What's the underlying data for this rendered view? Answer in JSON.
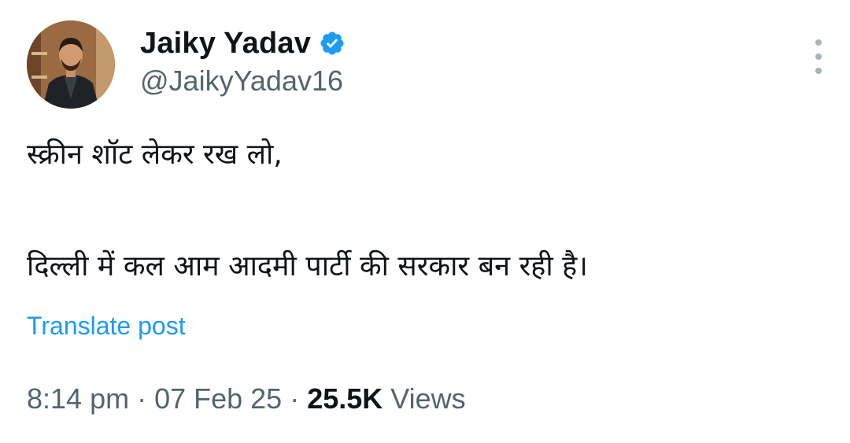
{
  "author": {
    "display_name": "Jaiky Yadav",
    "handle": "@JaikyYadav16",
    "verified": true,
    "verified_color": "#1d9bf0"
  },
  "tweet": {
    "lines": [
      "स्क्रीन शॉट लेकर रख लो,",
      "दिल्ली में कल आम आदमी पार्टी की सरकार बन रही है।"
    ],
    "translate_label": "Translate post"
  },
  "meta": {
    "time": "8:14 pm",
    "separator": " · ",
    "date": "07 Feb 25",
    "views_count": "25.5K",
    "views_label": " Views"
  },
  "icons": {
    "more": "more-vertical-icon",
    "verified": "verified-badge-icon"
  },
  "colors": {
    "text_primary": "#0f1419",
    "text_secondary": "#536471",
    "link": "#1d9bf0"
  }
}
